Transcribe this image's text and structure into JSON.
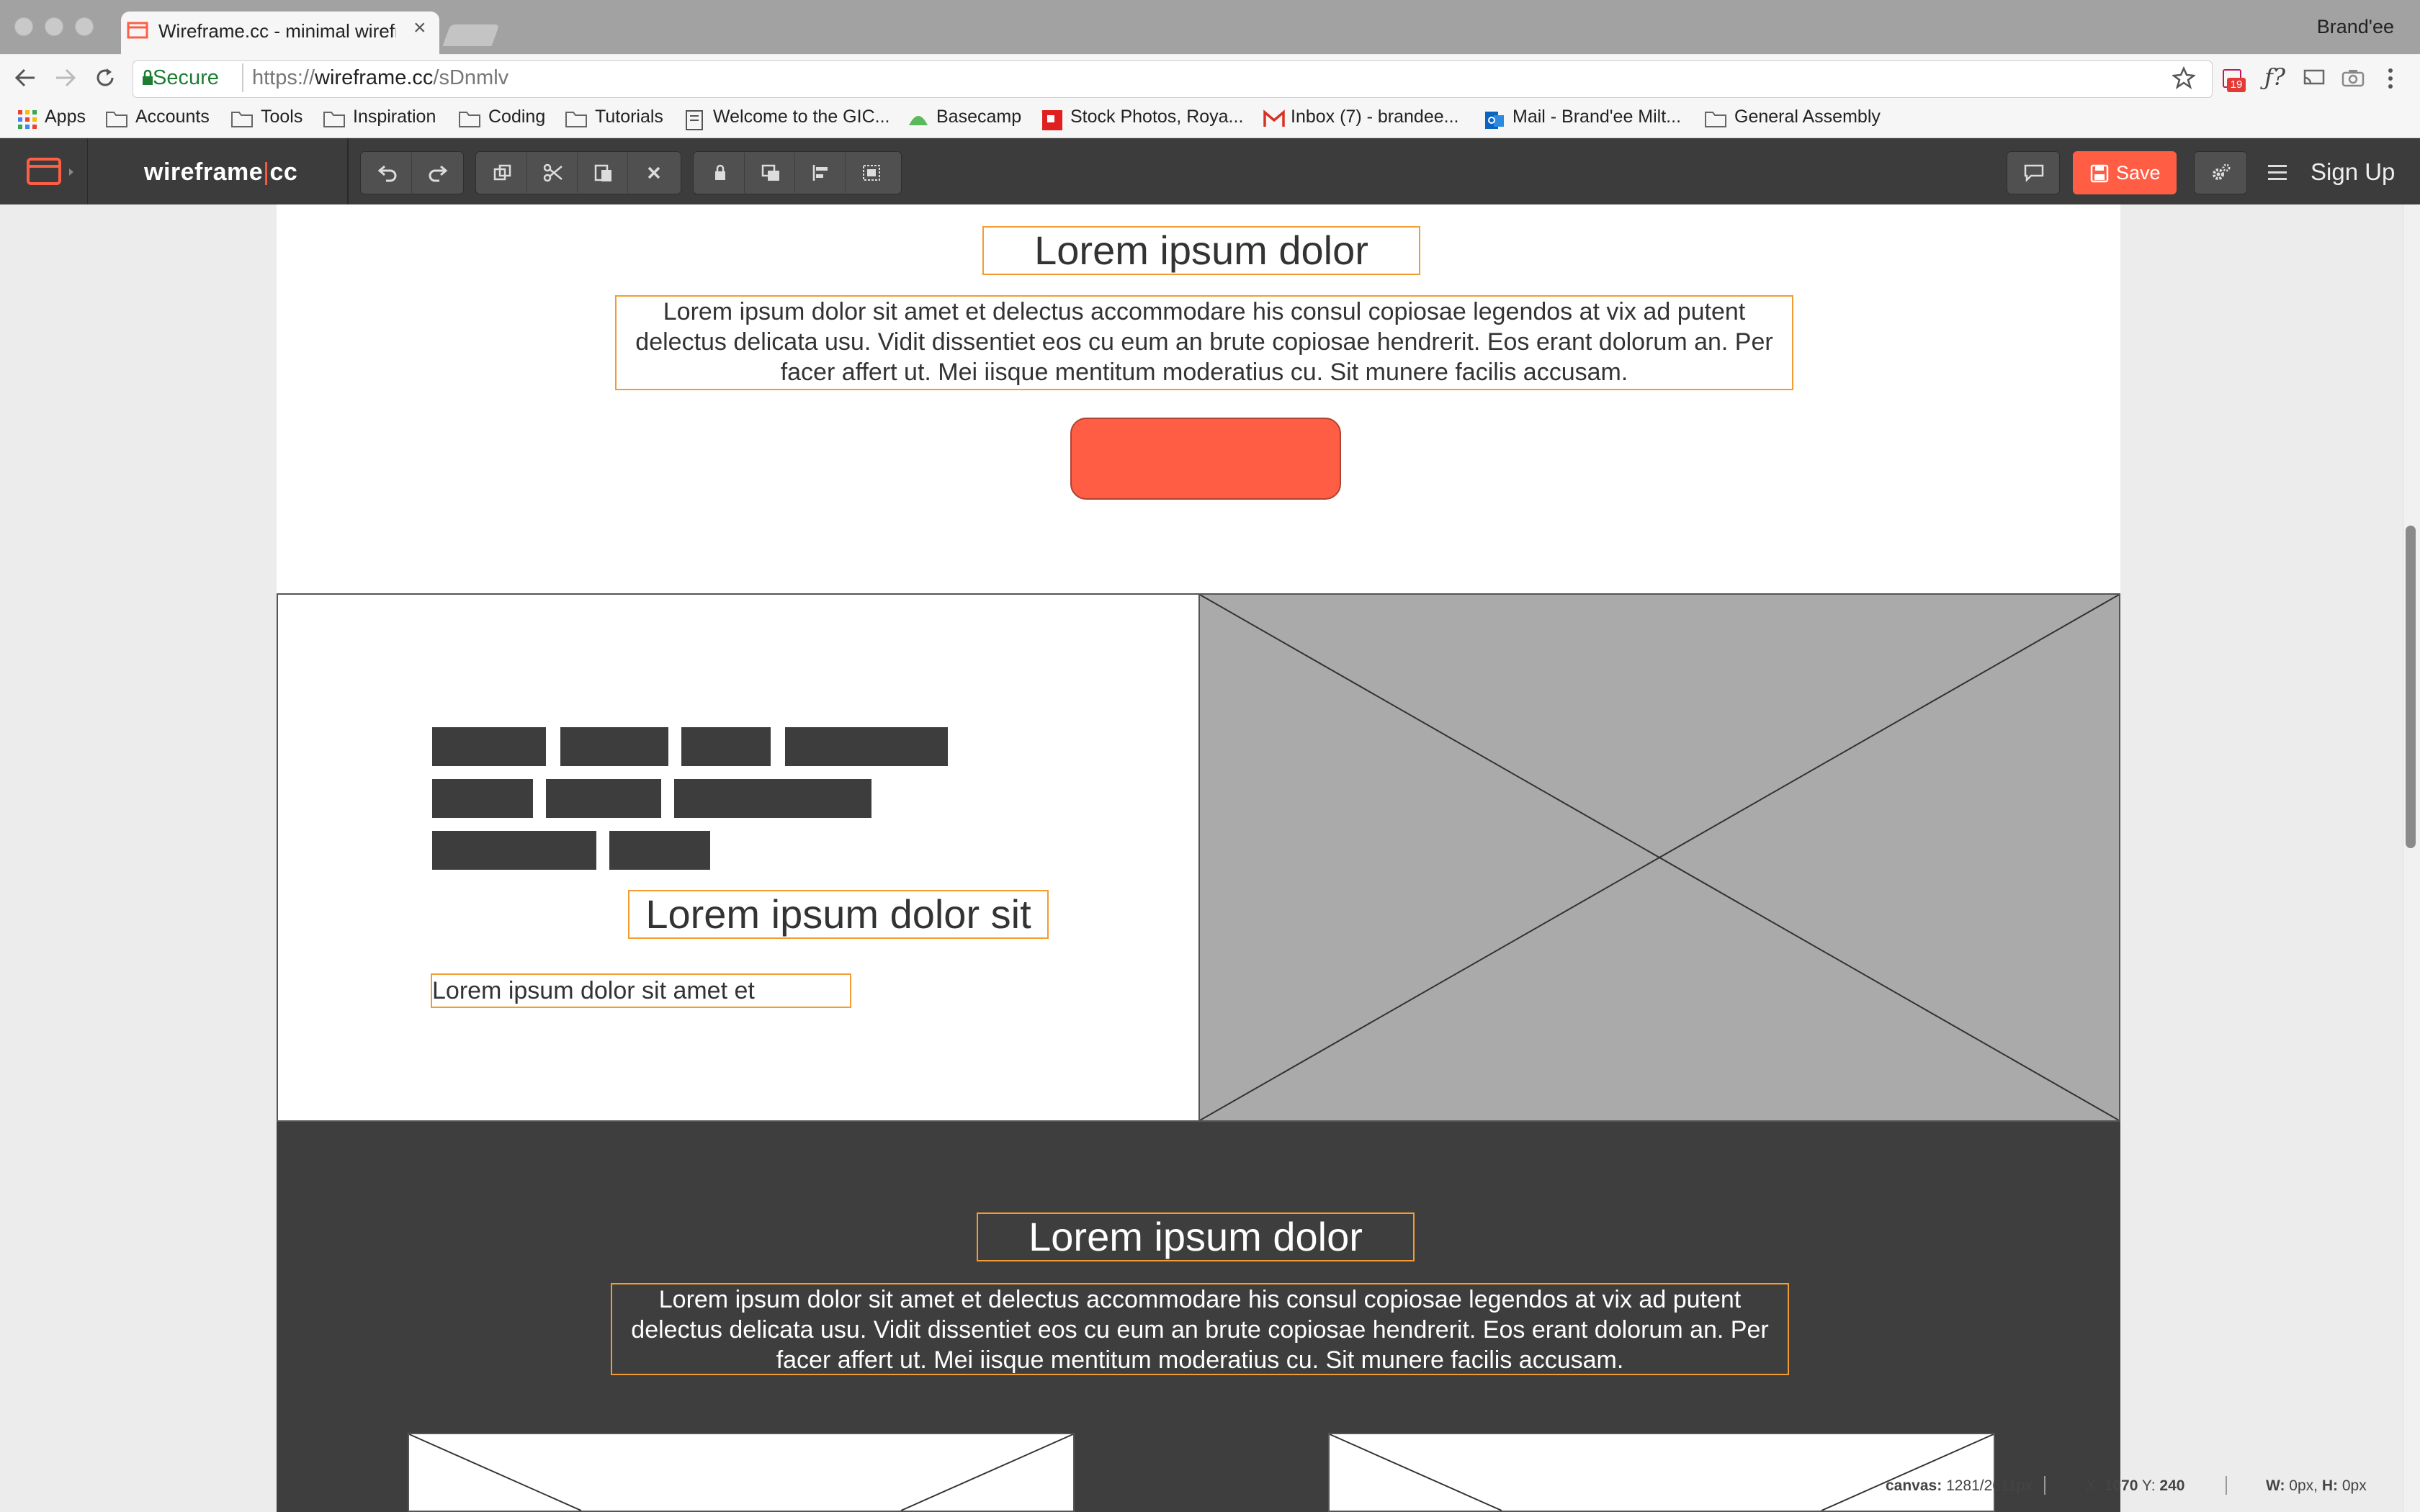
{
  "browser": {
    "tab_title": "Wireframe.cc - minimal wirefra",
    "tab_close": "×",
    "profile_name": "Brand'ee",
    "security_label": "Secure",
    "url_scheme": "https://",
    "url_host": "wireframe.cc",
    "url_path": "/sDnmlv",
    "badge_count": "19",
    "bookmarks": [
      {
        "label": "Apps",
        "icon": "apps-grid-icon"
      },
      {
        "label": "Accounts",
        "icon": "folder-icon"
      },
      {
        "label": "Tools",
        "icon": "folder-icon"
      },
      {
        "label": "Inspiration",
        "icon": "folder-icon"
      },
      {
        "label": "Coding",
        "icon": "folder-icon"
      },
      {
        "label": "Tutorials",
        "icon": "folder-icon"
      },
      {
        "label": "Welcome to the GIC...",
        "icon": "page-icon"
      },
      {
        "label": "Basecamp",
        "icon": "basecamp-icon"
      },
      {
        "label": "Stock Photos, Roya...",
        "icon": "stock-icon"
      },
      {
        "label": "Inbox (7) - brandee...",
        "icon": "gmail-icon"
      },
      {
        "label": "Mail - Brand'ee Milt...",
        "icon": "outlook-icon"
      },
      {
        "label": "General Assembly",
        "icon": "folder-icon"
      }
    ]
  },
  "app": {
    "logo_left": "wireframe",
    "logo_sep": "|",
    "logo_right": "cc",
    "save_label": "Save",
    "signup_label": "Sign Up",
    "accent_color": "#ff5e45"
  },
  "canvas": {
    "hero": {
      "heading": "Lorem ipsum dolor",
      "body": "Lorem ipsum dolor sit amet et delectus accommodare his consul copiosae legendos at vix ad putent delectus delicata usu. Vidit dissentiet eos cu eum an brute copiosae hendrerit. Eos erant dolorum an. Per facer affert ut. Mei iisque mentitum moderatius cu. Sit munere facilis accusam."
    },
    "feature": {
      "heading": "Lorem ipsum dolor sit",
      "caption": "Lorem ipsum dolor sit amet et"
    },
    "dark_section": {
      "heading": "Lorem ipsum dolor",
      "body": "Lorem ipsum dolor sit amet et delectus accommodare his consul copiosae legendos at vix ad putent delectus delicata usu. Vidit dissentiet eos cu eum an brute copiosae hendrerit. Eos erant dolorum an. Per facer affert ut. Mei iisque mentitum moderatius cu. Sit munere facilis accusam."
    }
  },
  "status_bar": {
    "canvas_label": "canvas:",
    "canvas_value": "1281/2611px",
    "x_label": "X:",
    "x_value": "1070",
    "y_label": "Y:",
    "y_value": "240",
    "w_label": "W:",
    "w_value": "0px,",
    "h_label": "H:",
    "h_value": "0px"
  }
}
